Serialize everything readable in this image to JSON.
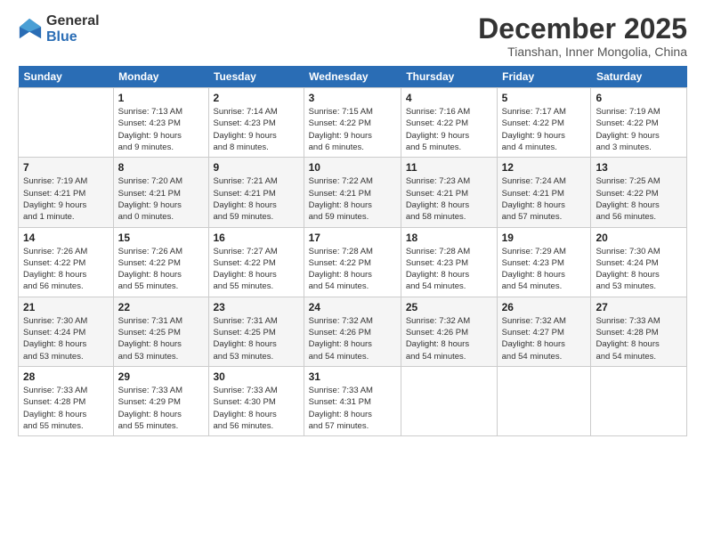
{
  "logo": {
    "line1": "General",
    "line2": "Blue"
  },
  "title": "December 2025",
  "subtitle": "Tianshan, Inner Mongolia, China",
  "days_header": [
    "Sunday",
    "Monday",
    "Tuesday",
    "Wednesday",
    "Thursday",
    "Friday",
    "Saturday"
  ],
  "weeks": [
    [
      {
        "day": "",
        "info": ""
      },
      {
        "day": "1",
        "info": "Sunrise: 7:13 AM\nSunset: 4:23 PM\nDaylight: 9 hours\nand 9 minutes."
      },
      {
        "day": "2",
        "info": "Sunrise: 7:14 AM\nSunset: 4:23 PM\nDaylight: 9 hours\nand 8 minutes."
      },
      {
        "day": "3",
        "info": "Sunrise: 7:15 AM\nSunset: 4:22 PM\nDaylight: 9 hours\nand 6 minutes."
      },
      {
        "day": "4",
        "info": "Sunrise: 7:16 AM\nSunset: 4:22 PM\nDaylight: 9 hours\nand 5 minutes."
      },
      {
        "day": "5",
        "info": "Sunrise: 7:17 AM\nSunset: 4:22 PM\nDaylight: 9 hours\nand 4 minutes."
      },
      {
        "day": "6",
        "info": "Sunrise: 7:19 AM\nSunset: 4:22 PM\nDaylight: 9 hours\nand 3 minutes."
      }
    ],
    [
      {
        "day": "7",
        "info": "Sunrise: 7:19 AM\nSunset: 4:21 PM\nDaylight: 9 hours\nand 1 minute."
      },
      {
        "day": "8",
        "info": "Sunrise: 7:20 AM\nSunset: 4:21 PM\nDaylight: 9 hours\nand 0 minutes."
      },
      {
        "day": "9",
        "info": "Sunrise: 7:21 AM\nSunset: 4:21 PM\nDaylight: 8 hours\nand 59 minutes."
      },
      {
        "day": "10",
        "info": "Sunrise: 7:22 AM\nSunset: 4:21 PM\nDaylight: 8 hours\nand 59 minutes."
      },
      {
        "day": "11",
        "info": "Sunrise: 7:23 AM\nSunset: 4:21 PM\nDaylight: 8 hours\nand 58 minutes."
      },
      {
        "day": "12",
        "info": "Sunrise: 7:24 AM\nSunset: 4:21 PM\nDaylight: 8 hours\nand 57 minutes."
      },
      {
        "day": "13",
        "info": "Sunrise: 7:25 AM\nSunset: 4:22 PM\nDaylight: 8 hours\nand 56 minutes."
      }
    ],
    [
      {
        "day": "14",
        "info": "Sunrise: 7:26 AM\nSunset: 4:22 PM\nDaylight: 8 hours\nand 56 minutes."
      },
      {
        "day": "15",
        "info": "Sunrise: 7:26 AM\nSunset: 4:22 PM\nDaylight: 8 hours\nand 55 minutes."
      },
      {
        "day": "16",
        "info": "Sunrise: 7:27 AM\nSunset: 4:22 PM\nDaylight: 8 hours\nand 55 minutes."
      },
      {
        "day": "17",
        "info": "Sunrise: 7:28 AM\nSunset: 4:22 PM\nDaylight: 8 hours\nand 54 minutes."
      },
      {
        "day": "18",
        "info": "Sunrise: 7:28 AM\nSunset: 4:23 PM\nDaylight: 8 hours\nand 54 minutes."
      },
      {
        "day": "19",
        "info": "Sunrise: 7:29 AM\nSunset: 4:23 PM\nDaylight: 8 hours\nand 54 minutes."
      },
      {
        "day": "20",
        "info": "Sunrise: 7:30 AM\nSunset: 4:24 PM\nDaylight: 8 hours\nand 53 minutes."
      }
    ],
    [
      {
        "day": "21",
        "info": "Sunrise: 7:30 AM\nSunset: 4:24 PM\nDaylight: 8 hours\nand 53 minutes."
      },
      {
        "day": "22",
        "info": "Sunrise: 7:31 AM\nSunset: 4:25 PM\nDaylight: 8 hours\nand 53 minutes."
      },
      {
        "day": "23",
        "info": "Sunrise: 7:31 AM\nSunset: 4:25 PM\nDaylight: 8 hours\nand 53 minutes."
      },
      {
        "day": "24",
        "info": "Sunrise: 7:32 AM\nSunset: 4:26 PM\nDaylight: 8 hours\nand 54 minutes."
      },
      {
        "day": "25",
        "info": "Sunrise: 7:32 AM\nSunset: 4:26 PM\nDaylight: 8 hours\nand 54 minutes."
      },
      {
        "day": "26",
        "info": "Sunrise: 7:32 AM\nSunset: 4:27 PM\nDaylight: 8 hours\nand 54 minutes."
      },
      {
        "day": "27",
        "info": "Sunrise: 7:33 AM\nSunset: 4:28 PM\nDaylight: 8 hours\nand 54 minutes."
      }
    ],
    [
      {
        "day": "28",
        "info": "Sunrise: 7:33 AM\nSunset: 4:28 PM\nDaylight: 8 hours\nand 55 minutes."
      },
      {
        "day": "29",
        "info": "Sunrise: 7:33 AM\nSunset: 4:29 PM\nDaylight: 8 hours\nand 55 minutes."
      },
      {
        "day": "30",
        "info": "Sunrise: 7:33 AM\nSunset: 4:30 PM\nDaylight: 8 hours\nand 56 minutes."
      },
      {
        "day": "31",
        "info": "Sunrise: 7:33 AM\nSunset: 4:31 PM\nDaylight: 8 hours\nand 57 minutes."
      },
      {
        "day": "",
        "info": ""
      },
      {
        "day": "",
        "info": ""
      },
      {
        "day": "",
        "info": ""
      }
    ]
  ]
}
